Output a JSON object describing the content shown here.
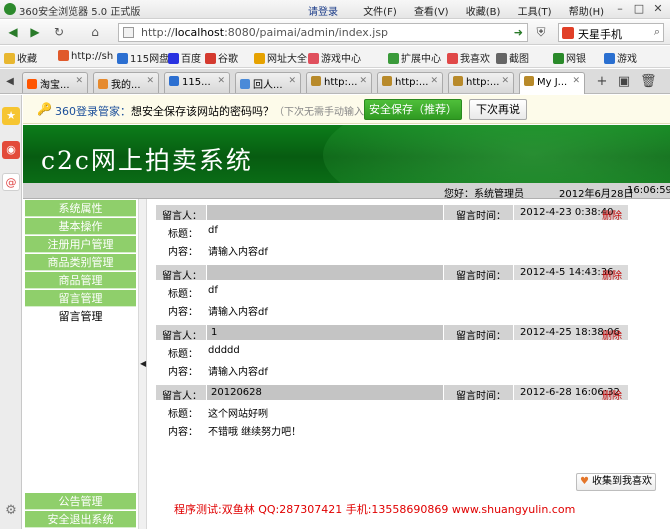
{
  "browser": {
    "title": "360安全浏览器 5.0 正式版",
    "login_link": "请登录",
    "menus": [
      "文件(F)",
      "查看(V)",
      "收藏(B)",
      "工具(T)",
      "帮助(H)"
    ],
    "url_prefix": "http://",
    "url_host": "localhost",
    "url_rest": ":8080/paimai/admin/index.jsp",
    "search_text": "天星手机",
    "favorites": [
      {
        "label": "收藏",
        "icon": "star-icon",
        "color": "#e8b730"
      },
      {
        "label": "http://sh",
        "icon": "page-icon",
        "color": "#e05a2b"
      },
      {
        "label": "115网盘",
        "icon": "page-icon",
        "color": "#2c6fd1"
      },
      {
        "label": "百度",
        "icon": "page-icon",
        "color": "#2932e1"
      },
      {
        "label": "谷歌",
        "icon": "page-icon",
        "color": "#d43a2f"
      },
      {
        "label": "网址大全",
        "icon": "page-icon",
        "color": "#e6a200"
      },
      {
        "label": "游戏中心",
        "icon": "page-icon",
        "color": "#e0505d"
      },
      {
        "label": "扩展中心",
        "icon": "page-icon",
        "color": "#3a9a3a"
      },
      {
        "label": "我喜欢",
        "icon": "heart-icon",
        "color": "#e04848"
      },
      {
        "label": "截图",
        "icon": "page-icon",
        "color": "#666666"
      },
      {
        "label": "网银",
        "icon": "page-icon",
        "color": "#2a8a2a"
      },
      {
        "label": "游戏",
        "icon": "page-icon",
        "color": "#2a6fd0"
      }
    ],
    "tabs": [
      {
        "label": "淘宝...",
        "color": "#ff5500",
        "active": false
      },
      {
        "label": "我的...",
        "color": "#e68a2e",
        "active": false
      },
      {
        "label": "115...",
        "color": "#2c6fd1",
        "active": false
      },
      {
        "label": "回人...",
        "color": "#4a8ad8",
        "active": false
      },
      {
        "label": "http:...",
        "color": "#b88a2a",
        "active": false
      },
      {
        "label": "http:...",
        "color": "#b88a2a",
        "active": false
      },
      {
        "label": "http:...",
        "color": "#b88a2a",
        "active": false
      },
      {
        "label": "My J...",
        "color": "#b88a2a",
        "active": true
      }
    ]
  },
  "notify": {
    "brand": "360登录管家：",
    "message": "想安全保存该网站的密码吗？",
    "hint": "（下次无需手动输入）",
    "save_button": "安全保存（推荐）",
    "later_button": "下次再说"
  },
  "app": {
    "system_title": "c2c网上拍卖系统",
    "greeting": "您好：",
    "username": "系统管理员",
    "date": "2012年6月28日",
    "time": "16:06:59",
    "menu": [
      {
        "label": "系统属性",
        "type": "header"
      },
      {
        "label": "基本操作",
        "type": "header"
      },
      {
        "label": "注册用户管理",
        "type": "header"
      },
      {
        "label": "商品类别管理",
        "type": "header"
      },
      {
        "label": "商品管理",
        "type": "header"
      },
      {
        "label": "留言管理",
        "type": "header"
      },
      {
        "label": "留言管理",
        "type": "sub"
      }
    ],
    "menu_bottom": [
      "公告管理",
      "安全退出系统"
    ],
    "labels": {
      "author": "留言人：",
      "time": "留言时间：",
      "delete": "删除",
      "subject": "标题：",
      "content": "内容："
    },
    "messages": [
      {
        "author": "",
        "time": "2012-4-23 0:38:40",
        "subject": "df",
        "content": "请输入内容df"
      },
      {
        "author": "",
        "time": "2012-4-5 14:43:36",
        "subject": "df",
        "content": "请输入内容df"
      },
      {
        "author": "1",
        "time": "2012-4-25 18:38:06",
        "subject": "ddddd",
        "content": "请输入内容df"
      },
      {
        "author": "20120628",
        "time": "2012-6-28 16:06:32",
        "subject": "这个网站好咧",
        "content": "不错哦  继续努力吧！"
      }
    ],
    "favorite_button": "收集到我喜欢",
    "credit": "程序测试:双鱼林 QQ:287307421 手机:13558690869 www.shuangyulin.com"
  }
}
